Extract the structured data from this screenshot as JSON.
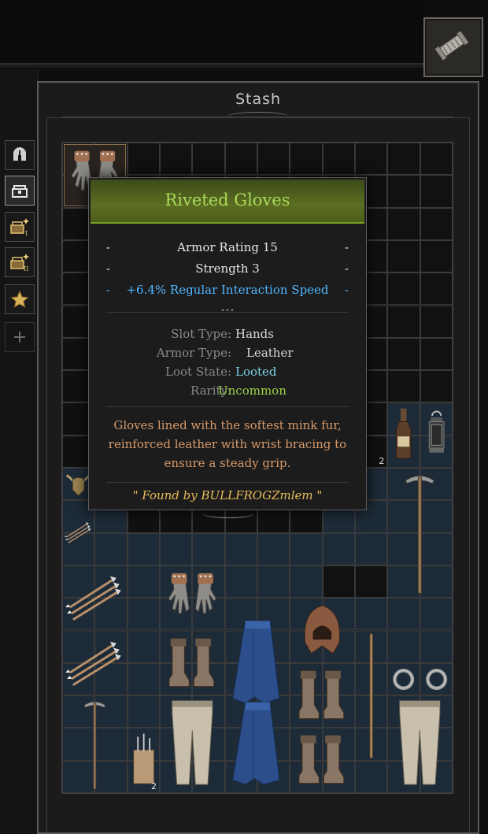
{
  "panel": {
    "title": "Stash"
  },
  "sidebar": {
    "tabs": [
      {
        "name": "helmet-tab-icon",
        "active": false
      },
      {
        "name": "stash-chest-tab-icon",
        "active": true
      },
      {
        "name": "stash-tab-i-icon",
        "active": false
      },
      {
        "name": "stash-tab-ii-icon",
        "active": false
      },
      {
        "name": "star-tab-icon",
        "active": false
      },
      {
        "name": "plus-tab-icon",
        "active": false
      }
    ]
  },
  "tooltip": {
    "item_name": "Riveted Gloves",
    "rarity_color": "#a9d957",
    "stats": [
      {
        "text": "Armor Rating 15",
        "kind": "stat"
      },
      {
        "text": "Strength 3",
        "kind": "stat"
      },
      {
        "text": "+6.4% Regular Interaction Speed",
        "kind": "bonus"
      }
    ],
    "dash": "-",
    "dots": "•••",
    "properties": [
      {
        "key": "Slot Type",
        "value": "Hands",
        "value_color": "#d8d8d8"
      },
      {
        "key": "Armor Type",
        "value": "Leather",
        "value_color": "#d8d8d8"
      },
      {
        "key": "Loot State",
        "value": "Looted",
        "value_color": "#7fd0e6"
      },
      {
        "key": "Rarity",
        "value": "Uncommon",
        "value_color": "#9bd34a"
      }
    ],
    "colon": ":",
    "description": "Gloves lined with the softest mink fur, reinforced leather with wrist bracing to ensure a steady grip.",
    "found_by": "\" Found by BULLFROGZmlem \""
  },
  "grid": {
    "columns": 12,
    "rows": 20
  },
  "items": [
    {
      "name": "riveted-gloves-item",
      "quantity": ""
    },
    {
      "name": "bottle-item",
      "quantity": ""
    },
    {
      "name": "lantern-item",
      "quantity": ""
    },
    {
      "name": "pickaxe-item",
      "quantity": ""
    },
    {
      "name": "horned-helm-item",
      "quantity": ""
    },
    {
      "name": "lockpick-item",
      "quantity": "2"
    },
    {
      "name": "arrows-item",
      "quantity": ""
    },
    {
      "name": "arrows-item",
      "quantity": ""
    },
    {
      "name": "arrows-item",
      "quantity": ""
    },
    {
      "name": "riveted-gloves-item",
      "quantity": ""
    },
    {
      "name": "leather-boots-item",
      "quantity": ""
    },
    {
      "name": "blue-cloak-item",
      "quantity": ""
    },
    {
      "name": "leather-hood-item",
      "quantity": ""
    },
    {
      "name": "leather-boots-item",
      "quantity": ""
    },
    {
      "name": "staff-item",
      "quantity": ""
    },
    {
      "name": "ring-item",
      "quantity": ""
    },
    {
      "name": "ring-item",
      "quantity": ""
    },
    {
      "name": "pickaxe-item",
      "quantity": ""
    },
    {
      "name": "trousers-item",
      "quantity": ""
    },
    {
      "name": "blue-cloak-item",
      "quantity": ""
    },
    {
      "name": "leather-boots-item",
      "quantity": ""
    },
    {
      "name": "trousers-item",
      "quantity": ""
    },
    {
      "name": "surgical-kit-item",
      "quantity": "2"
    }
  ]
}
